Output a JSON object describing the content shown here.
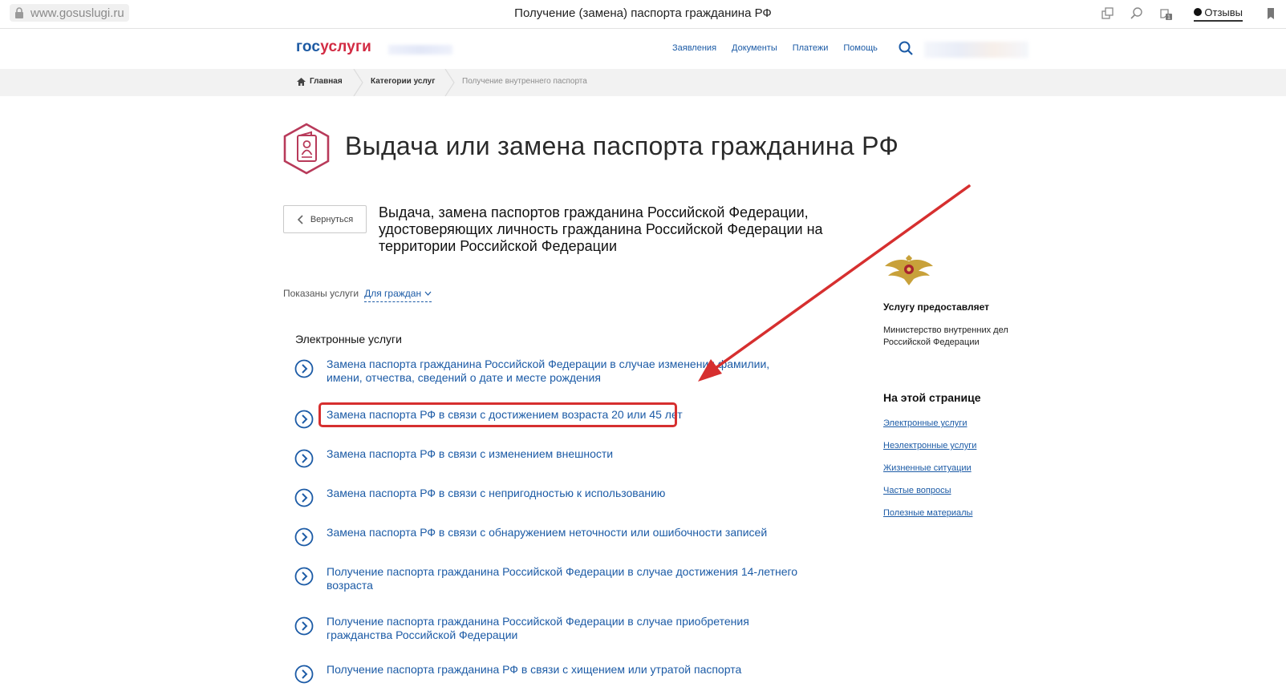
{
  "browser": {
    "url": "www.gosuslugi.ru",
    "window_title": "Получение (замена) паспорта гражданина РФ",
    "feedback_label": "Отзывы"
  },
  "header": {
    "logo_part1": "гос",
    "logo_part2": "услуги",
    "nav": [
      "Заявления",
      "Документы",
      "Платежи",
      "Помощь"
    ]
  },
  "breadcrumb": {
    "home": "Главная",
    "category": "Категории услуг",
    "current": "Получение внутреннего паспорта"
  },
  "page": {
    "title": "Выдача или замена паспорта гражданина РФ",
    "back_label": "Вернуться",
    "subtitle": "Выдача, замена паспортов гражданина Российской Федерации, удостоверяющих личность гражданина Российской Федерации на территории Российской Федерации",
    "filter_label": "Показаны услуги",
    "filter_value": "Для граждан"
  },
  "services": {
    "section_title": "Электронные услуги",
    "items": [
      "Замена паспорта гражданина Российской Федерации в случае изменения фамилии, имени, отчества, сведений о дате и месте рождения",
      "Замена паспорта РФ в связи с достижением возраста 20 или 45 лет",
      "Замена паспорта РФ в связи с изменением внешности",
      "Замена паспорта РФ в связи с непригодностью к использованию",
      "Замена паспорта РФ в связи с обнаружением неточности или ошибочности записей",
      "Получение паспорта гражданина Российской Федерации в случае достижения 14-летнего возраста",
      "Получение паспорта гражданина Российской Федерации в случае приобретения гражданства Российской Федерации",
      "Получение паспорта гражданина РФ в связи с хищением или утратой паспорта"
    ]
  },
  "sidebar": {
    "provider_title": "Услугу предоставляет",
    "provider_name": "Министерство внутренних дел Российской Федерации",
    "onpage_title": "На этой странице",
    "links": [
      "Электронные услуги",
      "Неэлектронные услуги",
      "Жизненные ситуации",
      "Частые вопросы",
      "Полезные материалы"
    ]
  },
  "colors": {
    "link": "#1c5ba6",
    "logo_blue": "#1d5aa3",
    "logo_red": "#d22b43",
    "annotation_red": "#d62f2f",
    "icon_crimson": "#b83a5a"
  }
}
